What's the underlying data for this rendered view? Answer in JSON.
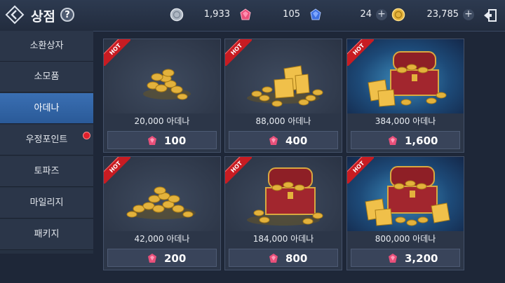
{
  "header": {
    "title": "상점",
    "help_label": "?"
  },
  "currencies": {
    "silver": "1,933",
    "ruby": "105",
    "sapphire": "24",
    "adena": "23,785",
    "plus": "+"
  },
  "sidebar": {
    "items": [
      {
        "label": "소환상자"
      },
      {
        "label": "소모품"
      },
      {
        "label": "아데나"
      },
      {
        "label": "우정포인트"
      },
      {
        "label": "토파즈"
      },
      {
        "label": "마일리지"
      },
      {
        "label": "패키지"
      }
    ],
    "active_index": 2
  },
  "products": [
    {
      "badge": "HOT",
      "amount": "20,000 아데나",
      "price": "100",
      "art": "small-coin-pile"
    },
    {
      "badge": "HOT",
      "amount": "88,000 아데나",
      "price": "400",
      "art": "gold-bars-coins"
    },
    {
      "badge": "HOT",
      "amount": "384,000 아데나",
      "price": "1,600",
      "art": "treasure-chest"
    },
    {
      "badge": "HOT",
      "amount": "42,000 아데나",
      "price": "200",
      "art": "coin-pile"
    },
    {
      "badge": "HOT",
      "amount": "184,000 아데나",
      "price": "800",
      "art": "treasure-chest"
    },
    {
      "badge": "HOT",
      "amount": "800,000 아데나",
      "price": "3,200",
      "art": "big-treasure-chest"
    }
  ],
  "colors": {
    "accent_blue": "#2f64a6",
    "hot_red": "#c81c22",
    "gem_pink": "#e8507a",
    "gold": "#e3b23c"
  }
}
